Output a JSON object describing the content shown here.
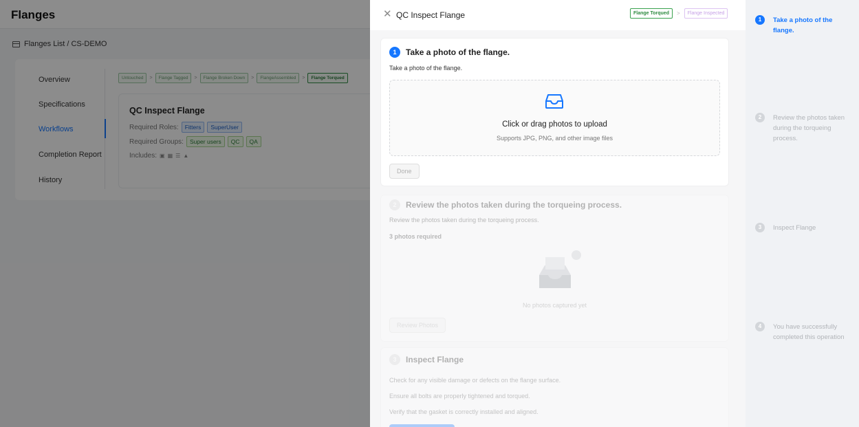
{
  "background": {
    "app_title": "Flanges",
    "breadcrumb": "Flanges List / CS-DEMO",
    "nav": [
      "Overview",
      "Specifications",
      "Workflows",
      "Completion Report",
      "History"
    ],
    "pipeline": [
      "Untouched",
      "Flange Tagged",
      "Flange Broken Down",
      "FlangeAssembled",
      "Flange Torqued"
    ],
    "workflow": {
      "title": "QC Inspect Flange",
      "roles_label": "Required Roles:",
      "roles": [
        "Fitters",
        "SuperUser"
      ],
      "groups_label": "Required Groups:",
      "groups": [
        "Super users",
        "QC",
        "QA"
      ],
      "includes_label": "Includes:"
    }
  },
  "drawer": {
    "title": "QC Inspect Flange",
    "from_state": "Flange Torqued",
    "to_state": "Flange Inspected",
    "steps": [
      {
        "num": "1",
        "title": "Take a photo of the flange.",
        "desc": "Take a photo of the flange.",
        "upload_text": "Click or drag photos to upload",
        "upload_hint": "Supports JPG, PNG, and other image files",
        "button": "Done"
      },
      {
        "num": "2",
        "title": "Review the photos taken during the torqueing process.",
        "desc": "Review the photos taken during the torqueing process.",
        "requirement": "3 photos required",
        "empty_text": "No photos captured yet",
        "button": "Review Photos"
      },
      {
        "num": "3",
        "title": "Inspect Flange",
        "lines": [
          "Check for any visible damage or defects on the flange surface.",
          "Ensure all bolts are properly tightened and torqued.",
          "Verify that the gasket is correctly installed and aligned."
        ]
      }
    ]
  },
  "steps_sidebar": [
    {
      "num": "1",
      "label": "Take a photo of the flange."
    },
    {
      "num": "2",
      "label": "Review the photos taken during the torqueing process."
    },
    {
      "num": "3",
      "label": "Inspect Flange"
    },
    {
      "num": "4",
      "label": "You have successfully completed this operation"
    }
  ],
  "colors": {
    "accent": "#1677ff",
    "success": "#38a14d",
    "overlay": "rgba(0,0,0,0.45)"
  }
}
